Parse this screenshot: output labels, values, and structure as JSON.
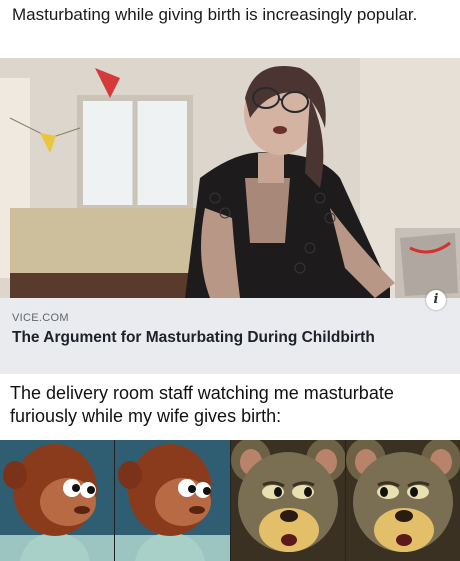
{
  "post": {
    "header_text": "Masturbating while giving birth is increasingly popular."
  },
  "article": {
    "source": "VICE.COM",
    "headline": "The Argument for Masturbating During Childbirth",
    "info_glyph": "i"
  },
  "meme": {
    "caption": "The delivery room staff watching me masturbate furiously while my wife gives birth:",
    "panels": [
      "puppet-monkey-glance",
      "puppet-monkey-glance",
      "cartoon-mouse-side-eye",
      "cartoon-mouse-side-eye"
    ]
  },
  "colors": {
    "card_meta_bg": "#e9ebee",
    "monkey_fur": "#8a3b1c",
    "mouse_fur": "#7a6f52"
  }
}
